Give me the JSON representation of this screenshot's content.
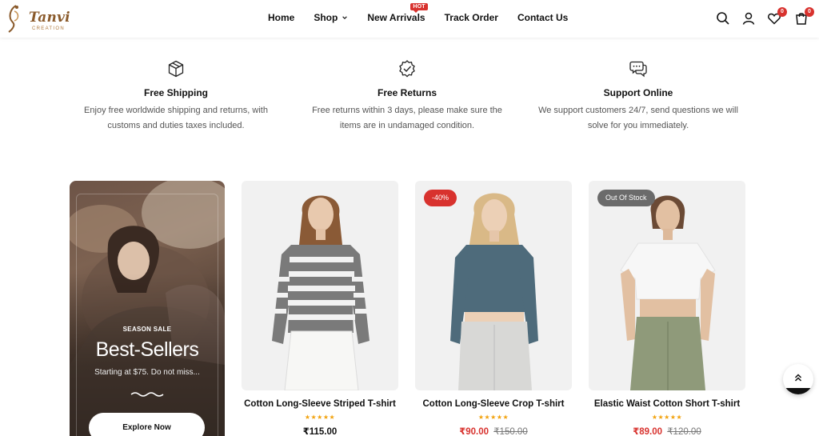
{
  "header": {
    "logo_text": "Tanvi",
    "logo_sub": "CREATION",
    "nav": [
      {
        "label": "Home"
      },
      {
        "label": "Shop"
      },
      {
        "label": "New Arrivals",
        "badge": "HOT"
      },
      {
        "label": "Track Order"
      },
      {
        "label": "Contact Us"
      }
    ],
    "wishlist_count": "0",
    "cart_count": "0"
  },
  "features": [
    {
      "icon": "box-icon",
      "title": "Free Shipping",
      "line1": "Enjoy free worldwide shipping and returns, with",
      "line2": "customs and duties taxes included."
    },
    {
      "icon": "badge-check-icon",
      "title": "Free Returns",
      "line1": "Free returns within 3 days, please make sure the",
      "line2": "items are in undamaged condition."
    },
    {
      "icon": "chat-icon",
      "title": "Support Online",
      "line1": "We support customers 24/7, send questions we will",
      "line2": "solve for you immediately."
    }
  ],
  "promo": {
    "kicker": "SEASON SALE",
    "title": "Best-Sellers",
    "subtitle": "Starting at $75. Do not miss...",
    "button": "Explore Now"
  },
  "products": [
    {
      "name": "Cotton Long-Sleeve Striped T-shirt",
      "rating": "★★★★★",
      "price": "₹115.00",
      "old_price": "",
      "tag": ""
    },
    {
      "name": "Cotton Long-Sleeve Crop T-shirt",
      "rating": "★★★★★",
      "price": "₹90.00",
      "old_price": "₹150.00",
      "tag": "-40%"
    },
    {
      "name": "Elastic Waist Cotton Short T-shirt",
      "rating": "★★★★★",
      "price": "₹89.00",
      "old_price": "₹120.00",
      "tag": "Out Of Stock"
    }
  ],
  "colors": {
    "accent": "#d8322e",
    "rating": "#f2a20d",
    "text": "#111111"
  }
}
